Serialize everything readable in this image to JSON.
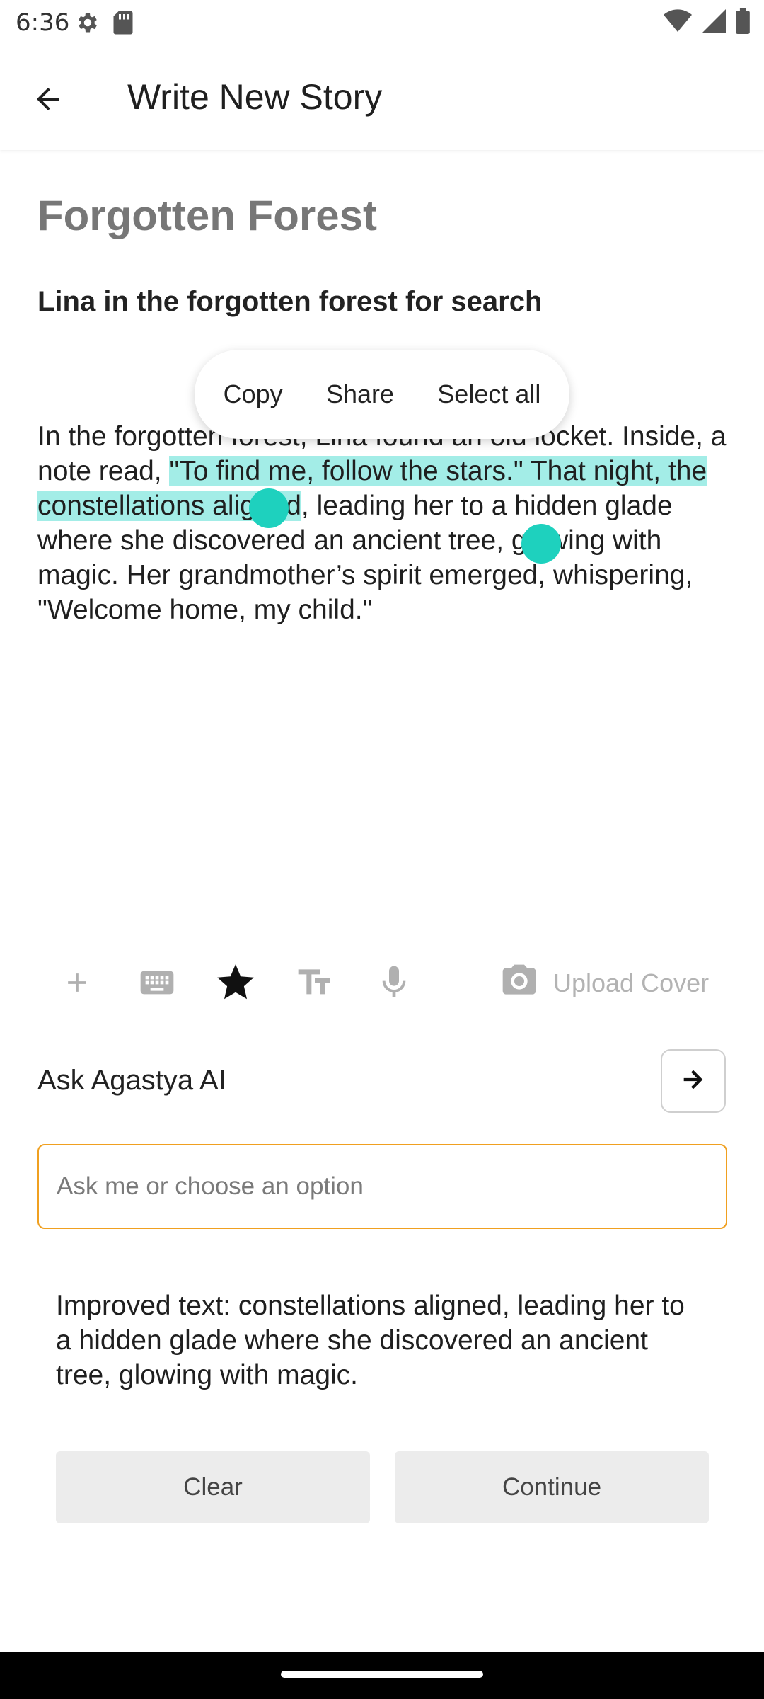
{
  "status_bar": {
    "time": "6:36",
    "left_icons": [
      "gear-icon",
      "sd-card-icon"
    ],
    "right_icons": [
      "wifi-icon",
      "signal-icon",
      "battery-icon"
    ]
  },
  "app_bar": {
    "back_icon": "arrow-left-icon",
    "title": "Write New Story"
  },
  "story": {
    "title": "Forgotten Forest",
    "subtitle": "Lina in the forgotten forest for search",
    "body_before": "In the forgotten forest, Lina found an old locket. Inside, a note read, ",
    "body_selected": "\"To find me, follow the stars.\" That night, the constellations aligned",
    "body_after": ", leading her to a hidden glade where she discovered an ancient tree, glowing with magic. Her grandmother’s spirit emerged, whispering, \"Welcome home, my child.\"",
    "selection_color": "#a3ede7",
    "handle_color": "#1ed1be"
  },
  "context_menu": {
    "items": [
      "Copy",
      "Share",
      "Select all"
    ]
  },
  "toolbar": {
    "icons": [
      "plus-icon",
      "keyboard-icon",
      "star-icon",
      "text-size-icon",
      "microphone-icon"
    ],
    "upload_label": "Upload Cover",
    "upload_icon": "camera-icon"
  },
  "ask_ai": {
    "label": "Ask Agastya AI",
    "send_icon": "arrow-right-icon",
    "input_placeholder": "Ask me or choose an option",
    "input_value": "",
    "accent_color": "#f0a020"
  },
  "result": {
    "improved_text": "Improved text: constellations aligned, leading her to a hidden glade where she discovered an ancient tree, glowing with magic."
  },
  "actions": {
    "clear_label": "Clear",
    "continue_label": "Continue"
  }
}
